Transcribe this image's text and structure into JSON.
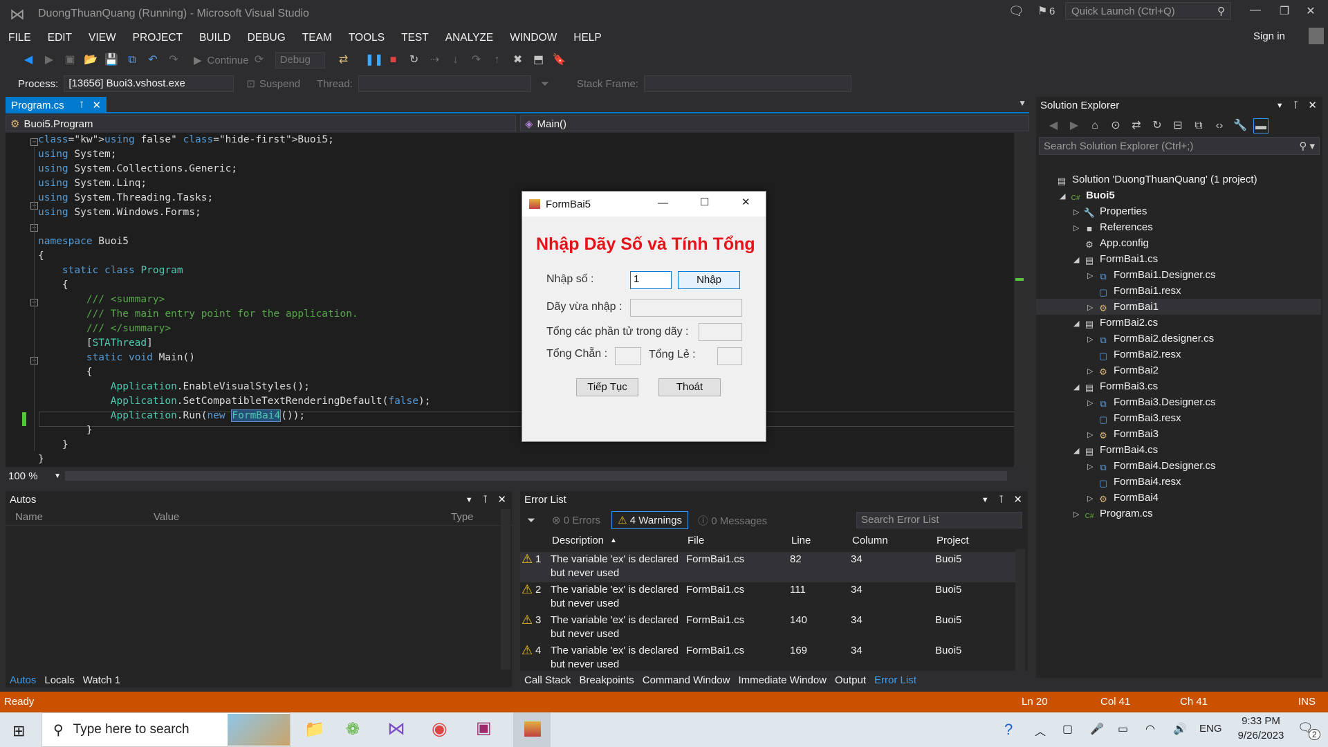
{
  "window": {
    "title": "DuongThuanQuang (Running) - Microsoft Visual Studio",
    "notif_count": "6",
    "quick_launch_placeholder": "Quick Launch (Ctrl+Q)",
    "sign_in": "Sign in"
  },
  "menu": [
    "FILE",
    "EDIT",
    "VIEW",
    "PROJECT",
    "BUILD",
    "DEBUG",
    "TEAM",
    "TOOLS",
    "TEST",
    "ANALYZE",
    "WINDOW",
    "HELP"
  ],
  "toolbar": {
    "continue_label": "Continue",
    "config": "Debug"
  },
  "debugbar": {
    "process_label": "Process:",
    "process_value": "[13656] Buoi3.vshost.exe",
    "suspend": "Suspend",
    "thread_label": "Thread:",
    "stack_frame_label": "Stack Frame:"
  },
  "editor": {
    "tab": "Program.cs",
    "nav_left": "Buoi5.Program",
    "nav_right": "Main()",
    "zoom": "100 %",
    "lines": [
      "using Buoi5;",
      "using System;",
      "using System.Collections.Generic;",
      "using System.Linq;",
      "using System.Threading.Tasks;",
      "using System.Windows.Forms;",
      "",
      "namespace Buoi5",
      "{",
      "    static class Program",
      "    {",
      "        /// <summary>",
      "        /// The main entry point for the application.",
      "        /// </summary>",
      "        [STAThread]",
      "        static void Main()",
      "        {",
      "            Application.EnableVisualStyles();",
      "            Application.SetCompatibleTextRenderingDefault(false);",
      "            Application.Run(new FormBai4());",
      "        }",
      "    }",
      "}"
    ]
  },
  "dialog": {
    "title": "FormBai5",
    "heading": "Nhập Dãy Số và Tính Tổng",
    "input_label": "Nhập số :",
    "input_value": "1",
    "enter_button": "Nhập",
    "seq_label": "Dãy vừa nhập :",
    "sum_label": "Tổng các phần tử trong dãy :",
    "even_label": "Tổng Chẵn :",
    "odd_label": "Tổng Lẻ :",
    "continue_button": "Tiếp Tục",
    "exit_button": "Thoát"
  },
  "autos": {
    "title": "Autos",
    "columns": [
      "Name",
      "Value",
      "Type"
    ],
    "tabs": [
      "Autos",
      "Locals",
      "Watch 1"
    ]
  },
  "errorlist": {
    "title": "Error List",
    "errors": "0 Errors",
    "warnings": "4 Warnings",
    "messages": "0 Messages",
    "search_placeholder": "Search Error List",
    "columns": [
      "Description",
      "File",
      "Line",
      "Column",
      "Project"
    ],
    "rows": [
      {
        "num": "1",
        "desc1": "The variable 'ex' is declared",
        "desc2": "but never used",
        "file": "FormBai1.cs",
        "line": "82",
        "col": "34",
        "project": "Buoi5"
      },
      {
        "num": "2",
        "desc1": "The variable 'ex' is declared",
        "desc2": "but never used",
        "file": "FormBai1.cs",
        "line": "111",
        "col": "34",
        "project": "Buoi5"
      },
      {
        "num": "3",
        "desc1": "The variable 'ex' is declared",
        "desc2": "but never used",
        "file": "FormBai1.cs",
        "line": "140",
        "col": "34",
        "project": "Buoi5"
      },
      {
        "num": "4",
        "desc1": "The variable 'ex' is declared",
        "desc2": "but never used",
        "file": "FormBai1.cs",
        "line": "169",
        "col": "34",
        "project": "Buoi5"
      }
    ],
    "tabs": [
      "Call Stack",
      "Breakpoints",
      "Command Window",
      "Immediate Window",
      "Output",
      "Error List"
    ]
  },
  "solution": {
    "title": "Solution Explorer",
    "search_placeholder": "Search Solution Explorer (Ctrl+;)",
    "items": [
      "Solution 'DuongThuanQuang' (1 project)",
      "Buoi5",
      "Properties",
      "References",
      "App.config",
      "FormBai1.cs",
      "FormBai1.Designer.cs",
      "FormBai1.resx",
      "FormBai1",
      "FormBai2.cs",
      "FormBai2.designer.cs",
      "FormBai2.resx",
      "FormBai2",
      "FormBai3.cs",
      "FormBai3.Designer.cs",
      "FormBai3.resx",
      "FormBai3",
      "FormBai4.cs",
      "FormBai4.Designer.cs",
      "FormBai4.resx",
      "FormBai4",
      "Program.cs"
    ]
  },
  "status": {
    "ready": "Ready",
    "ln": "Ln 20",
    "col": "Col 41",
    "ch": "Ch 41",
    "ins": "INS"
  },
  "taskbar": {
    "search_placeholder": "Type here to search",
    "lang": "ENG",
    "time": "9:33 PM",
    "date": "9/26/2023",
    "notif": "2"
  }
}
